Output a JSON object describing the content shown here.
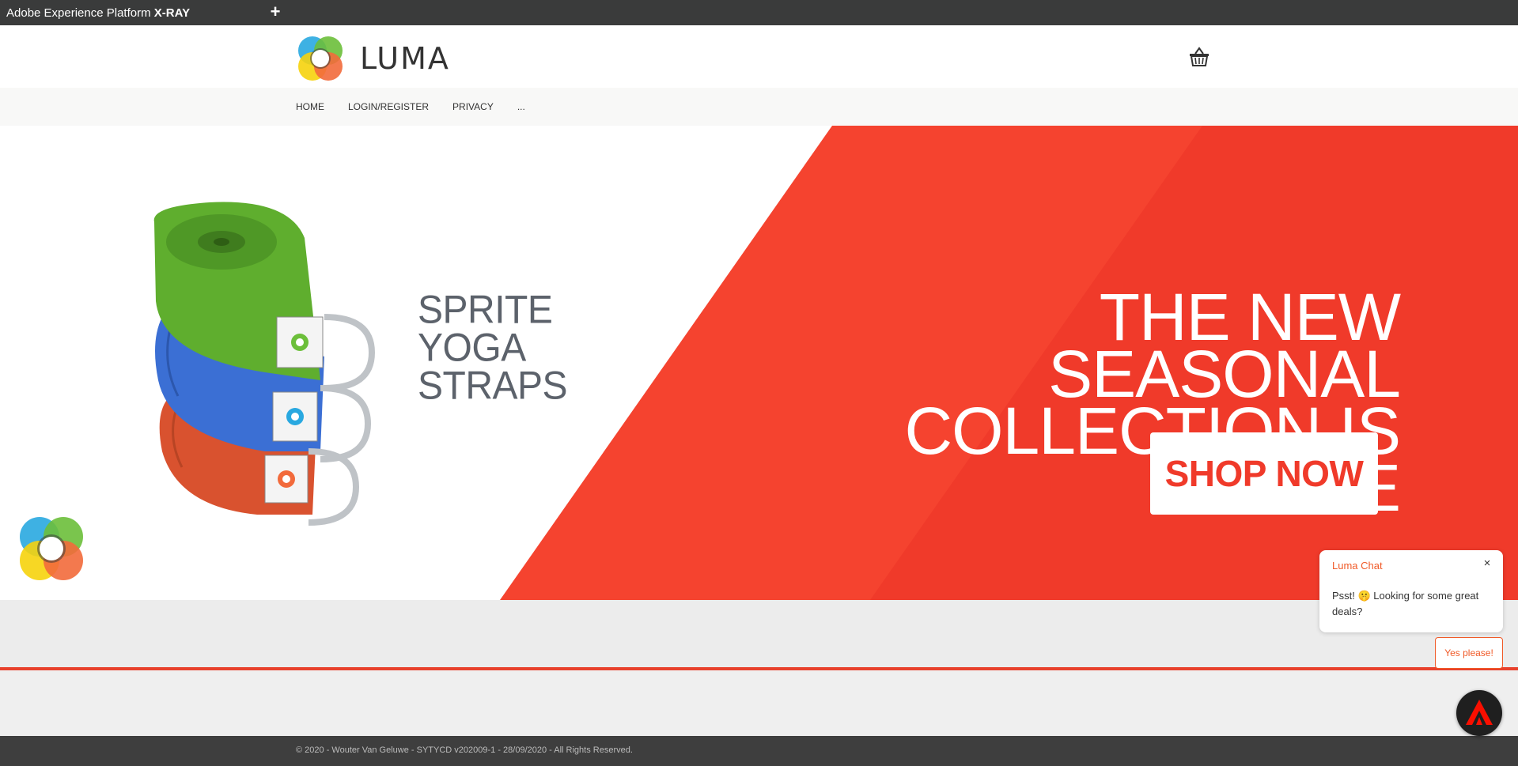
{
  "xray_bar": {
    "title_prefix": "Adobe Experience Platform",
    "title_bold": "X-RAY",
    "add_label": "+"
  },
  "header": {
    "logo_text": "LUMA",
    "cart_icon": "basket-icon"
  },
  "nav": {
    "items": [
      {
        "label": "HOME"
      },
      {
        "label": "LOGIN/REGISTER"
      },
      {
        "label": "PRIVACY"
      },
      {
        "label": "..."
      }
    ]
  },
  "hero": {
    "product_lines": [
      "SPRITE",
      "YOGA",
      "STRAPS"
    ],
    "headline_lines": [
      "THE NEW SEASONAL",
      "COLLECTION IS HERE"
    ],
    "cta_label": "SHOP NOW",
    "colors": {
      "accent": "#f03a2a",
      "text_grey": "#5c626b"
    }
  },
  "footer": {
    "text": "© 2020 - Wouter Van Geluwe - SYTYCD v202009-1 - 28/09/2020 - All Rights Reserved."
  },
  "chat": {
    "title": "Luma Chat",
    "close_label": "×",
    "message": "Psst! 🤫 Looking for some great deals?",
    "reply_label": "Yes please!"
  },
  "badge": {
    "icon": "adobe-logo-icon"
  }
}
